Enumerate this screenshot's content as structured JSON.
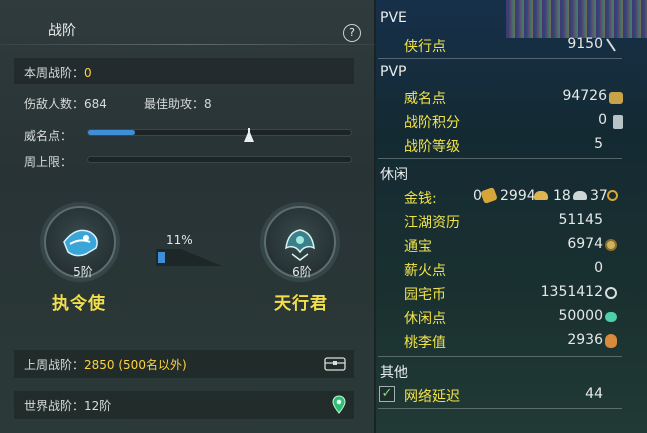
{
  "left": {
    "tab_title": "战阶",
    "help_icon": "?",
    "weekly_rank_label": "本周战阶：",
    "weekly_rank_value": "0",
    "injured_label": "伤敌人数：684",
    "assist_label": "最佳助攻：8",
    "prestige_label": "威名点：",
    "weekly_cap_label": "周上限：",
    "prestige_progress": 0.18,
    "progress_percent_text": "11%",
    "rank_progress": 0.11,
    "current_emblem_label": "5阶",
    "current_rank_name": "执令使",
    "next_emblem_label": "6阶",
    "next_rank_name": "天行君",
    "last_week_label": "上周战阶：",
    "last_week_value": "2850 (500名以外)",
    "world_rank_label": "世界战阶：12阶"
  },
  "right": {
    "pve_header": "PVE",
    "pve_items": [
      {
        "name": "侠行点",
        "value": "9150"
      }
    ],
    "pvp_header": "PVP",
    "pvp_items": [
      {
        "name": "威名点",
        "value": "94726"
      },
      {
        "name": "战阶积分",
        "value": "0"
      },
      {
        "name": "战阶等级",
        "value": "5"
      }
    ],
    "leisure_header": "休闲",
    "money_label": "金钱:",
    "money_values": {
      "a": "0",
      "b": "2994",
      "c": "18",
      "d": "37"
    },
    "leisure_items": [
      {
        "name": "江湖资历",
        "value": "51145"
      },
      {
        "name": "通宝",
        "value": "6974"
      },
      {
        "name": "薪火点",
        "value": "0"
      },
      {
        "name": "园宅币",
        "value": "1351412"
      },
      {
        "name": "休闲点",
        "value": "50000"
      },
      {
        "name": "桃李值",
        "value": "2936"
      }
    ],
    "other_header": "其他",
    "latency_label": "网络延迟",
    "latency_value": "44",
    "latency_checked": "✓"
  },
  "colors": {
    "gold_text": "#f1e24a",
    "rank_name": "#f2df4a",
    "progress_blue": "#3f8fd8"
  }
}
